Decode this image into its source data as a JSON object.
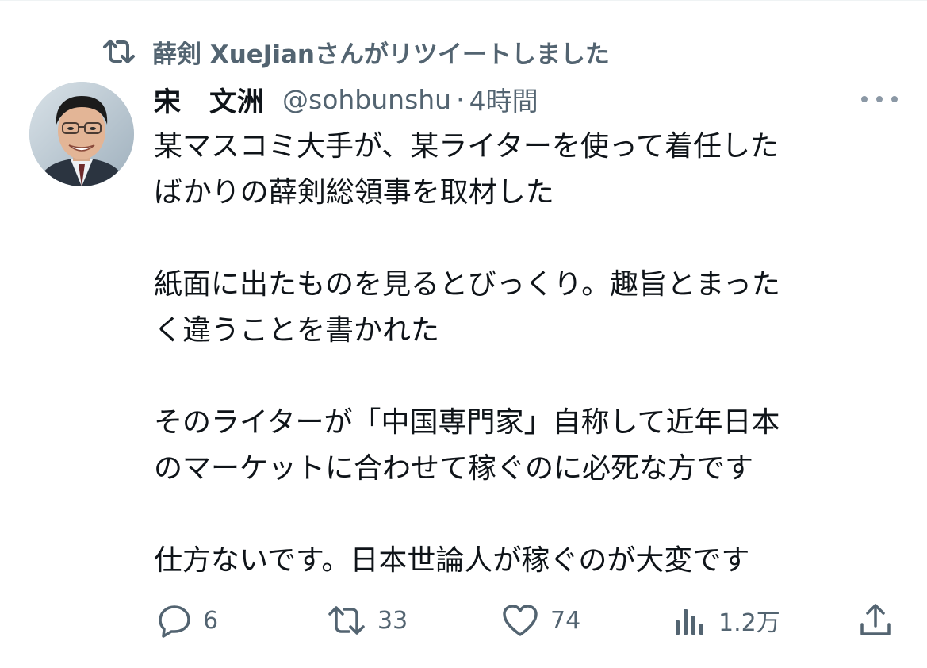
{
  "retweet": {
    "icon": "retweet-icon",
    "text": "薛剣 XueJianさんがリツイートしました"
  },
  "author": {
    "display_name": "宋　文洲",
    "handle": "@sohbunshu",
    "separator": "·",
    "time": "4時間",
    "avatar": "avatar-photo"
  },
  "tweet": {
    "paragraphs": [
      "某マスコミ大手が、某ライターを使って着任したばかりの薛剣総領事を取材した",
      "紙面に出たものを見るとびっくり。趣旨とまったく違うことを書かれた",
      "そのライターが「中国専門家」自称して近年日本のマーケットに合わせて稼ぐのに必死な方です",
      "仕方ないです。日本世論人が稼ぐのが大変です"
    ],
    "lines": [
      "某マスコミ大手が、某ライターを使って着任した",
      "ばかりの薛剣総領事を取材した",
      "紙面に出たものを見るとびっくり。趣旨とまった",
      "く違うことを書かれた",
      "そのライターが「中国専門家」自称して近年日本",
      "のマーケットに合わせて稼ぐのに必死な方です",
      "仕方ないです。日本世論人が稼ぐのが大変です"
    ]
  },
  "actions": {
    "reply": {
      "icon": "reply-icon",
      "count": "6"
    },
    "retweet": {
      "icon": "retweet-icon",
      "count": "33"
    },
    "like": {
      "icon": "heart-icon",
      "count": "74"
    },
    "views": {
      "icon": "views-icon",
      "count": "1.2万"
    },
    "share": {
      "icon": "share-icon"
    }
  },
  "colors": {
    "text": "#0f1419",
    "secondary": "#536471",
    "icon_gray": "#8b98a5"
  }
}
